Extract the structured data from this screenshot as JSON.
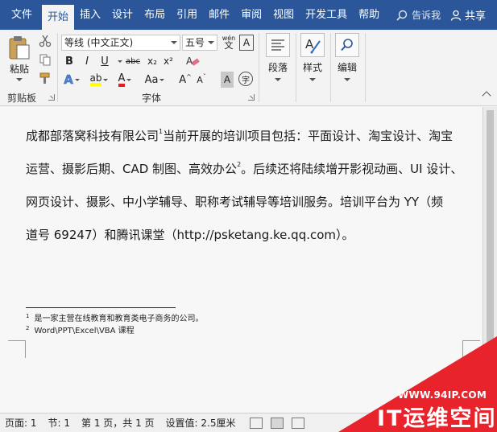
{
  "ribbon_tabs": [
    "文件",
    "开始",
    "插入",
    "设计",
    "布局",
    "引用",
    "邮件",
    "审阅",
    "视图",
    "开发工具",
    "帮助"
  ],
  "active_tab": "开始",
  "tell_me": "告诉我",
  "share": "共享",
  "clipboard": {
    "paste_label": "粘贴",
    "group_label": "剪贴板"
  },
  "font": {
    "font_name": "等线 (中文正文)",
    "font_size": "五号",
    "wen_label": "wén",
    "bold": "B",
    "italic": "I",
    "underline": "U",
    "strike": "abc",
    "subscript": "x₂",
    "superscript": "x²",
    "font_color_label": "A",
    "case_label": "Aa",
    "grow": "A",
    "shrink": "A",
    "char_shading": "A",
    "enclose": "字",
    "group_label": "字体"
  },
  "paragraph": {
    "label": "段落"
  },
  "styles": {
    "label": "样式"
  },
  "editing": {
    "label": "编辑"
  },
  "document": {
    "line1": "成都部落窝科技有限公司",
    "fn_ref1": "1",
    "line1b": "当前开展的培训项目包括：平面设计、淘宝设计、淘宝",
    "line2": "运营、摄影后期、CAD 制图、高效办公",
    "fn_ref2": "2",
    "line2b": "。后续还将陆续增开影视动画、UI 设计、",
    "line3": "网页设计、摄影、中小学辅导、职称考试辅导等培训服务。培训平台为 YY（频",
    "line4": "道号 69247）和腾讯课堂（http://psketang.ke.qq.com）。",
    "footnotes": [
      {
        "num": "1",
        "text": "是一家主营在线教育和教育类电子商务的公司。"
      },
      {
        "num": "2",
        "text": "Word\\PPT\\Excel\\VBA 课程"
      }
    ]
  },
  "status_bar": {
    "page": "页面: 1",
    "section": "节: 1",
    "page_of": "第 1 页，共 1 页",
    "setting": "设置值: 2.5厘米"
  },
  "watermark": {
    "url": "WWW.94IP.COM",
    "title": "IT运维空间",
    "color": "#e8232b"
  }
}
